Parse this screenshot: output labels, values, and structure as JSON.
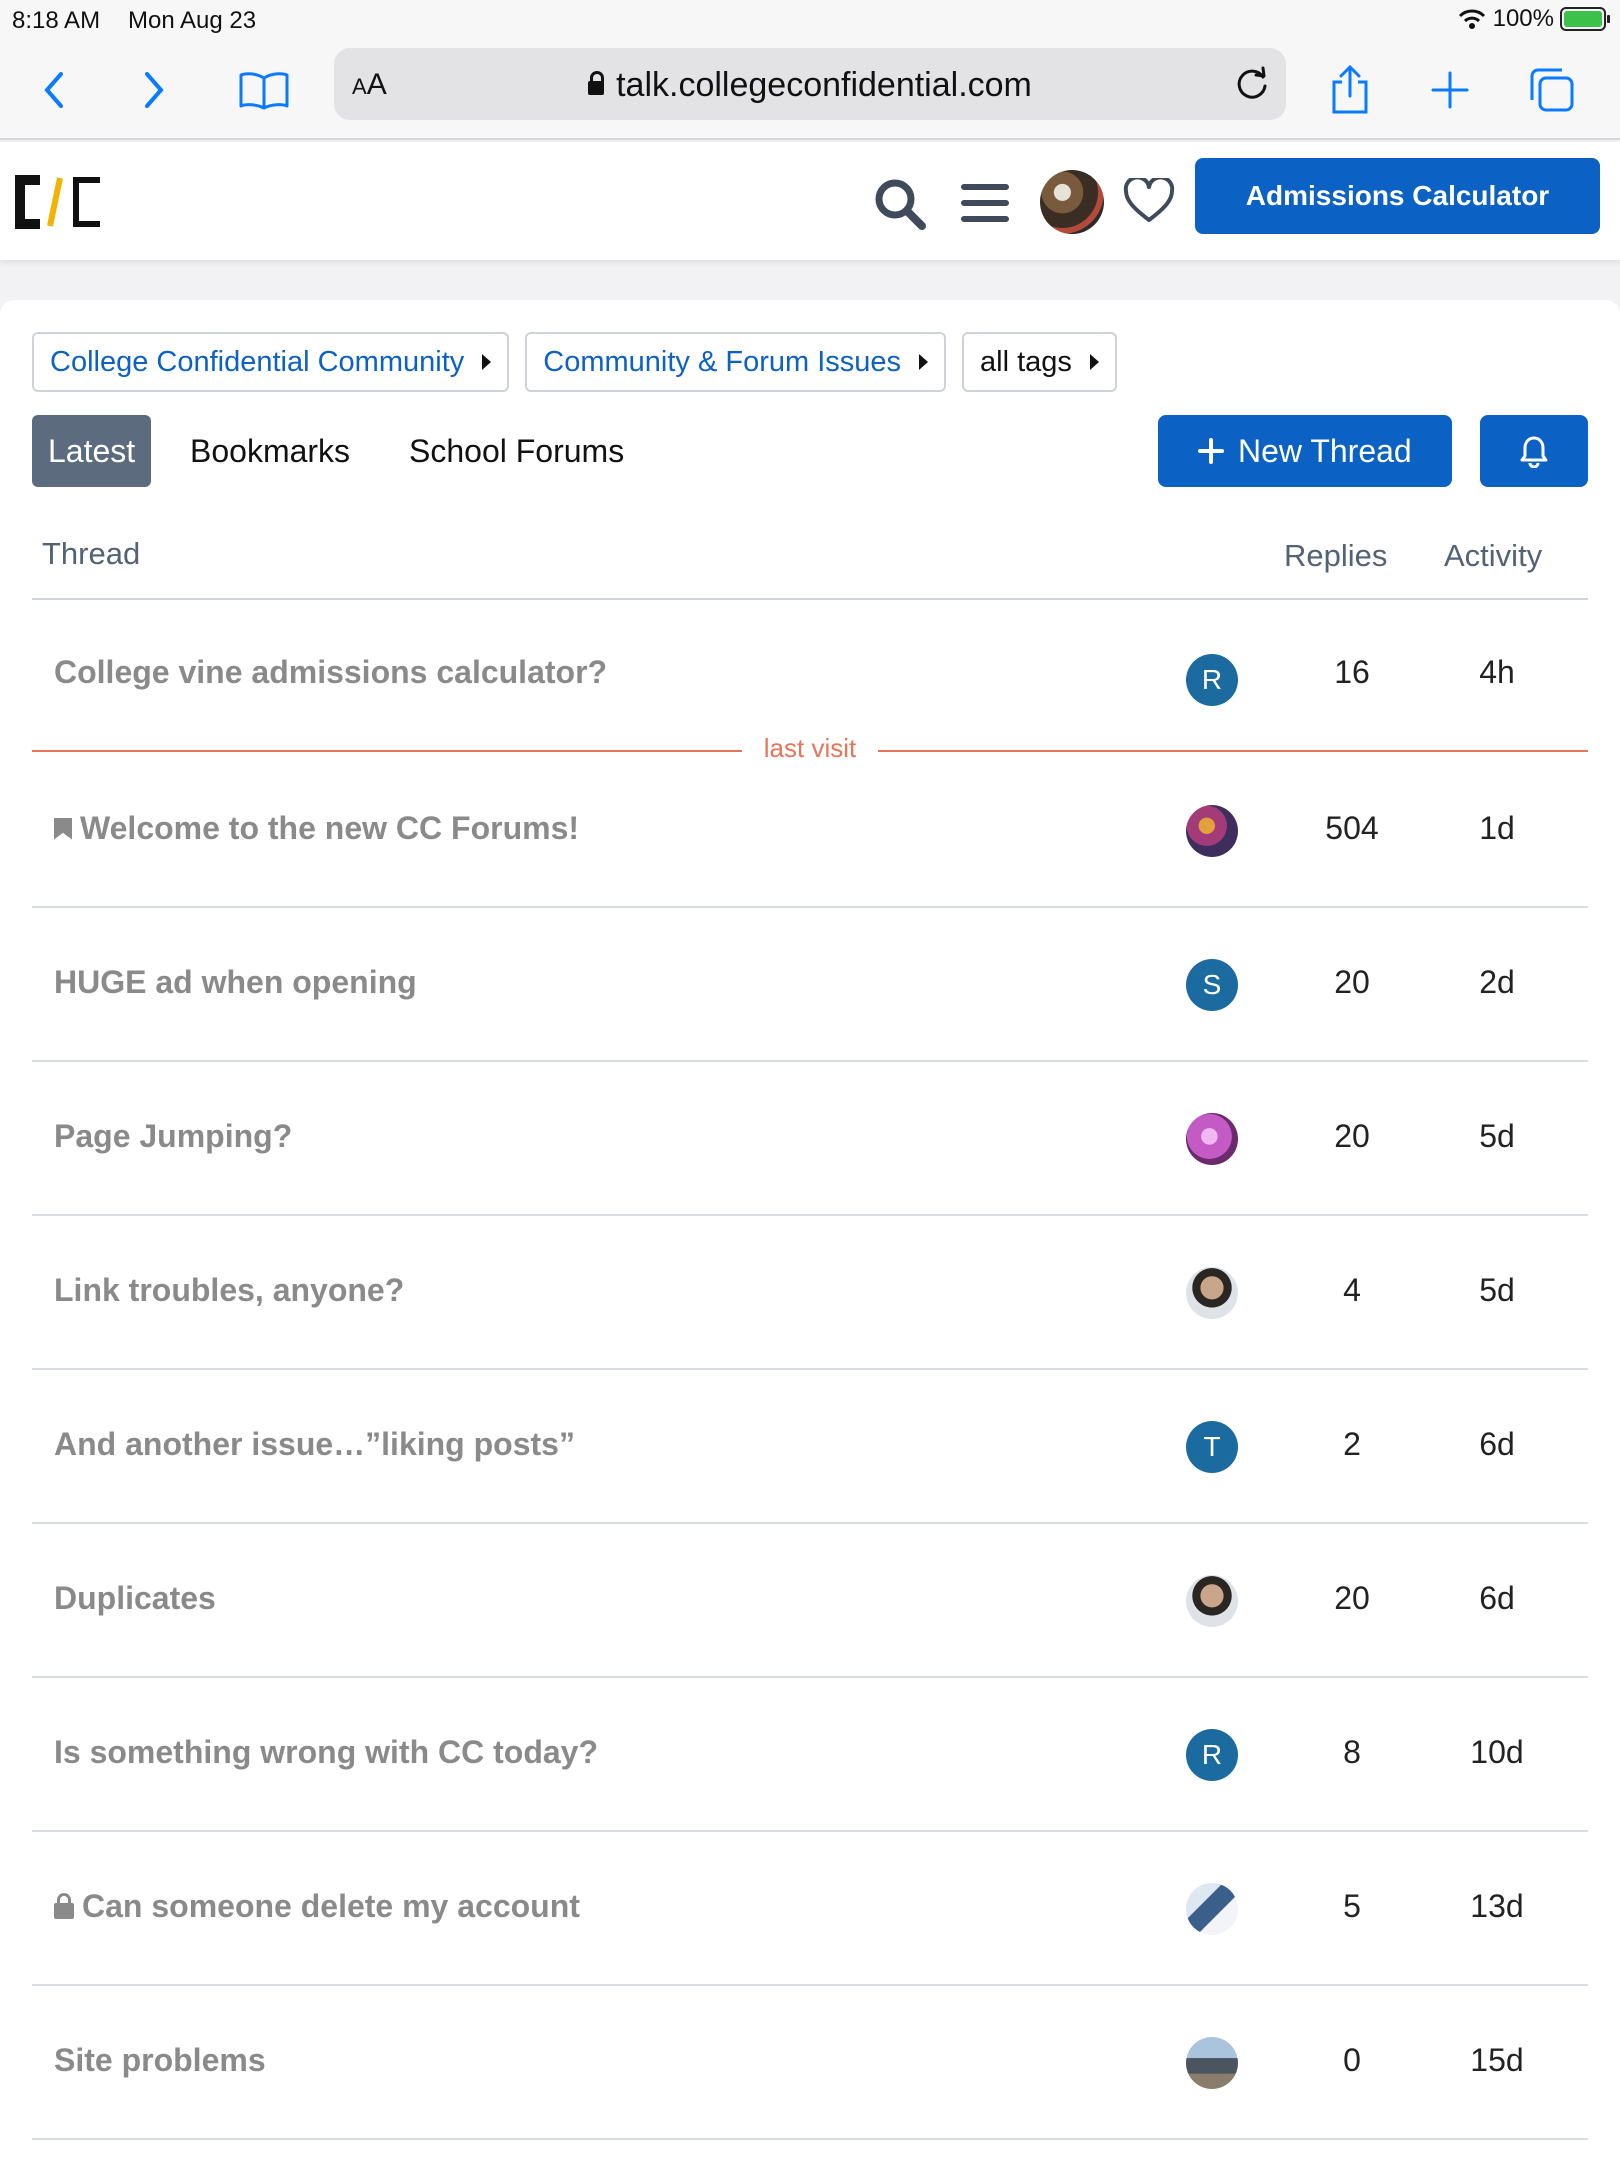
{
  "status_bar": {
    "time": "8:18 AM",
    "date": "Mon Aug 23",
    "battery": "100%"
  },
  "browser": {
    "url": "talk.collegeconfidential.com",
    "text_size_label": "AA"
  },
  "site": {
    "admissions_button": "Admissions Calculator"
  },
  "breadcrumbs": [
    {
      "label": "College Confidential Community"
    },
    {
      "label": "Community & Forum Issues"
    },
    {
      "label": "all tags"
    }
  ],
  "tabs": [
    {
      "label": "Latest",
      "active": true
    },
    {
      "label": "Bookmarks"
    },
    {
      "label": "School Forums"
    }
  ],
  "new_thread_label": "New Thread",
  "table": {
    "col_thread": "Thread",
    "col_replies": "Replies",
    "col_activity": "Activity"
  },
  "last_visit_label": "last visit",
  "threads": [
    {
      "title": "College vine admissions calculator?",
      "avatar_letter": "R",
      "avatar_color": "#1b6aa0",
      "replies": "16",
      "activity": "4h"
    },
    {
      "title": "Welcome to the new CC Forums!",
      "icon": "bookmark-icon",
      "avatar_letter": "",
      "avatar_color": "#6b3b5a",
      "replies": "504",
      "activity": "1d"
    },
    {
      "title": "HUGE ad when opening",
      "avatar_letter": "S",
      "avatar_color": "#1b6aa0",
      "replies": "20",
      "activity": "2d"
    },
    {
      "title": "Page Jumping?",
      "avatar_letter": "",
      "avatar_color": "#c45ac4",
      "replies": "20",
      "activity": "5d"
    },
    {
      "title": "Link troubles, anyone?",
      "avatar_letter": "",
      "avatar_color": "#5d5a57",
      "replies": "4",
      "activity": "5d"
    },
    {
      "title": "And another issue…”liking posts”",
      "avatar_letter": "T",
      "avatar_color": "#1b6aa0",
      "replies": "2",
      "activity": "6d"
    },
    {
      "title": "Duplicates",
      "avatar_letter": "",
      "avatar_color": "#5d5a57",
      "replies": "20",
      "activity": "6d"
    },
    {
      "title": "Is something wrong with CC today?",
      "avatar_letter": "R",
      "avatar_color": "#1b6aa0",
      "replies": "8",
      "activity": "10d"
    },
    {
      "title": "Can someone delete my account",
      "icon": "lock-icon",
      "avatar_letter": "",
      "avatar_color": "#7aa3c8",
      "replies": "5",
      "activity": "13d"
    },
    {
      "title": "Site problems",
      "avatar_letter": "",
      "avatar_color": "#6e7880",
      "replies": "0",
      "activity": "15d"
    }
  ]
}
